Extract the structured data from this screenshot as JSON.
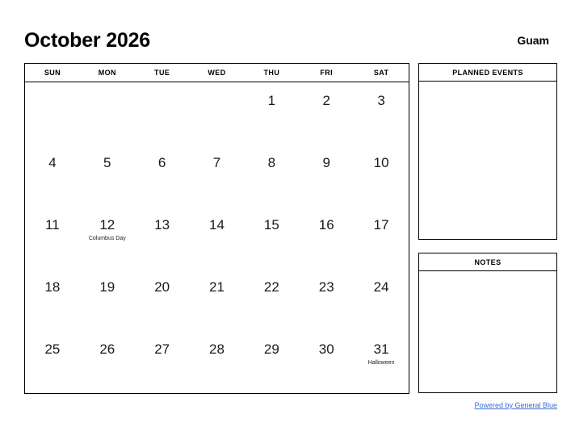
{
  "header": {
    "title": "October 2026",
    "locality": "Guam"
  },
  "calendar": {
    "day_names": [
      "SUN",
      "MON",
      "TUE",
      "WED",
      "THU",
      "FRI",
      "SAT"
    ],
    "weeks": [
      [
        {
          "day": "",
          "event": ""
        },
        {
          "day": "",
          "event": ""
        },
        {
          "day": "",
          "event": ""
        },
        {
          "day": "",
          "event": ""
        },
        {
          "day": "1",
          "event": ""
        },
        {
          "day": "2",
          "event": ""
        },
        {
          "day": "3",
          "event": ""
        }
      ],
      [
        {
          "day": "4",
          "event": ""
        },
        {
          "day": "5",
          "event": ""
        },
        {
          "day": "6",
          "event": ""
        },
        {
          "day": "7",
          "event": ""
        },
        {
          "day": "8",
          "event": ""
        },
        {
          "day": "9",
          "event": ""
        },
        {
          "day": "10",
          "event": ""
        }
      ],
      [
        {
          "day": "11",
          "event": ""
        },
        {
          "day": "12",
          "event": "Columbus Day"
        },
        {
          "day": "13",
          "event": ""
        },
        {
          "day": "14",
          "event": ""
        },
        {
          "day": "15",
          "event": ""
        },
        {
          "day": "16",
          "event": ""
        },
        {
          "day": "17",
          "event": ""
        }
      ],
      [
        {
          "day": "18",
          "event": ""
        },
        {
          "day": "19",
          "event": ""
        },
        {
          "day": "20",
          "event": ""
        },
        {
          "day": "21",
          "event": ""
        },
        {
          "day": "22",
          "event": ""
        },
        {
          "day": "23",
          "event": ""
        },
        {
          "day": "24",
          "event": ""
        }
      ],
      [
        {
          "day": "25",
          "event": ""
        },
        {
          "day": "26",
          "event": ""
        },
        {
          "day": "27",
          "event": ""
        },
        {
          "day": "28",
          "event": ""
        },
        {
          "day": "29",
          "event": ""
        },
        {
          "day": "30",
          "event": ""
        },
        {
          "day": "31",
          "event": "Halloween"
        }
      ]
    ]
  },
  "panels": {
    "planned_events": {
      "heading": "PLANNED EVENTS",
      "content": ""
    },
    "notes": {
      "heading": "NOTES",
      "content": ""
    }
  },
  "footer": {
    "link_text": "Powered by General Blue"
  },
  "colors": {
    "link": "#3b6fd4",
    "border": "#000000",
    "text": "#111111",
    "background": "#ffffff"
  }
}
